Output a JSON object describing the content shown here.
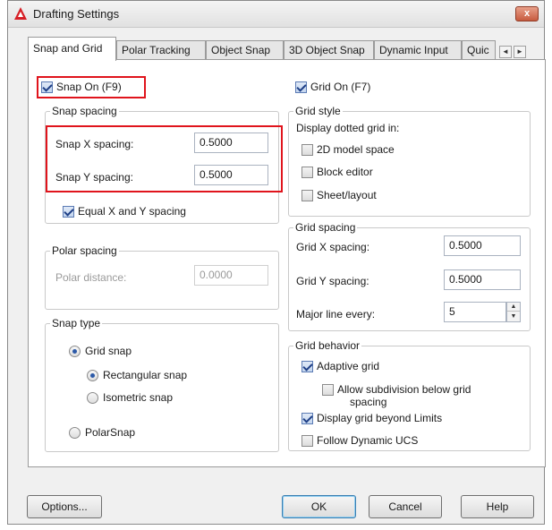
{
  "window": {
    "title": "Drafting Settings",
    "close_label": "x"
  },
  "tabs": [
    "Snap and Grid",
    "Polar Tracking",
    "Object Snap",
    "3D Object Snap",
    "Dynamic Input",
    "Quic"
  ],
  "tab_scroll": {
    "left": "◄",
    "right": "►"
  },
  "snap": {
    "snap_on_label": "Snap On (F9)",
    "spacing_group": "Snap spacing",
    "x_label": "Snap X spacing:",
    "x_value": "0.5000",
    "y_label": "Snap Y spacing:",
    "y_value": "0.5000",
    "equal_label": "Equal X and Y spacing"
  },
  "polar": {
    "group": "Polar spacing",
    "distance_label": "Polar distance:",
    "distance_value": "0.0000"
  },
  "snap_type": {
    "group": "Snap type",
    "grid_snap": "Grid snap",
    "rectangular": "Rectangular snap",
    "isometric": "Isometric snap",
    "polarsnap": "PolarSnap"
  },
  "grid": {
    "grid_on_label": "Grid On (F7)",
    "style_group": "Grid style",
    "display_dotted": "Display dotted grid in:",
    "model_space": "2D model space",
    "block_editor": "Block editor",
    "sheet_layout": "Sheet/layout",
    "spacing_group": "Grid spacing",
    "x_label": "Grid X spacing:",
    "x_value": "0.5000",
    "y_label": "Grid Y spacing:",
    "y_value": "0.5000",
    "major_label": "Major line every:",
    "major_value": "5",
    "behavior_group": "Grid behavior",
    "adaptive": "Adaptive grid",
    "allow_sub_line1": "Allow subdivision below grid",
    "allow_sub_line2": "spacing",
    "beyond_limits": "Display grid beyond Limits",
    "follow_ucs": "Follow Dynamic UCS"
  },
  "buttons": {
    "options": "Options...",
    "ok": "OK",
    "cancel": "Cancel",
    "help": "Help"
  },
  "colors": {
    "highlight": "#e0141c",
    "accent": "#2c5aa8"
  }
}
